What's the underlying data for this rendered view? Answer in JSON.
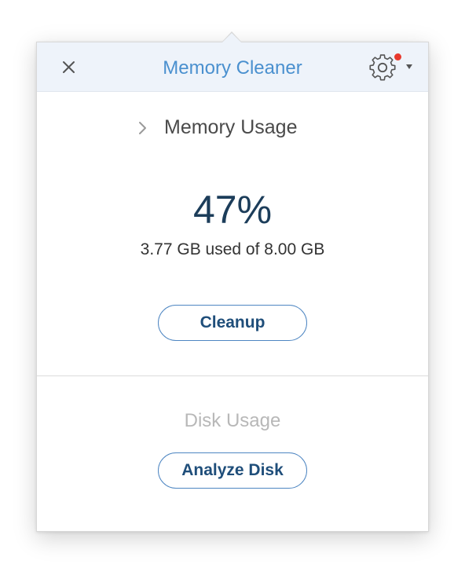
{
  "header": {
    "title": "Memory Cleaner",
    "close_icon": "close-icon",
    "settings_icon": "gear-icon",
    "has_notification": true,
    "dropdown_icon": "chevron-down-icon"
  },
  "memory": {
    "section_title": "Memory Usage",
    "expand_icon": "chevron-right-icon",
    "percent": "47%",
    "usage_text": "3.77 GB used of 8.00 GB",
    "cleanup_label": "Cleanup"
  },
  "disk": {
    "section_title": "Disk Usage",
    "analyze_label": "Analyze Disk"
  },
  "colors": {
    "title": "#4a90cf",
    "header_bg": "#eef3fa",
    "percent": "#1c3d5a",
    "button_border": "#4e86c2",
    "button_text": "#1f4e7a",
    "notification": "#e8392d",
    "disabled_text": "#b8b8b8"
  }
}
